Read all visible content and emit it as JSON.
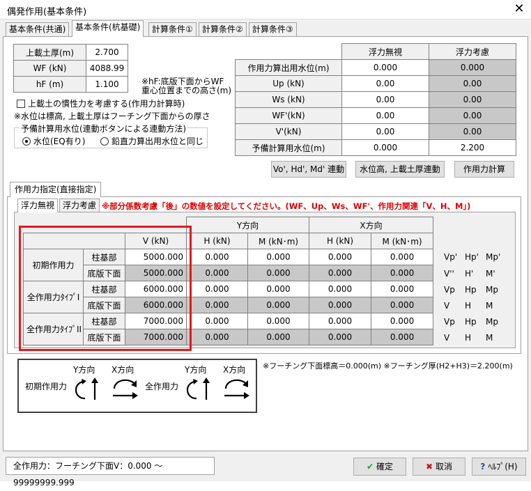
{
  "window": {
    "title": "偶発作用(基本条件)",
    "close": "✕"
  },
  "tabs": [
    "基本条件(共通)",
    "基本条件(杭基礎)",
    "計算条件①",
    "計算条件②",
    "計算条件③"
  ],
  "soil": {
    "rows": [
      {
        "label": "上載土厚(m)",
        "value": "2.700"
      },
      {
        "label": "WF (kN)",
        "value": "4088.99"
      },
      {
        "label": "hF (m)",
        "value": "1.100"
      }
    ],
    "hf_note_1": "※hF:底版下面からWF",
    "hf_note_2": "重心位置までの高さ(m)"
  },
  "inertia_checkbox": "上載土の慣性力を考慮する(作用力計算時)",
  "water_note": "※水位は標高, 上載土厚はフーチング下面からの厚さ",
  "reserve_group": {
    "title": "予備計算用水位(連動ボタンによる連動方法)",
    "option1": "水位(EQ有り)",
    "option2": "鉛直力算出用水位と同じ"
  },
  "buoyancy": {
    "headers": [
      "浮力無視",
      "浮力考慮"
    ],
    "rows": [
      {
        "label": "作用力算出用水位(m)",
        "a": "0.000",
        "b": "0.000"
      },
      {
        "label": "Up (kN)",
        "a": "0.00",
        "b": "0.00"
      },
      {
        "label": "Ws (kN)",
        "a": "0.00",
        "b": "0.00"
      },
      {
        "label": "WF'(kN)",
        "a": "0.00",
        "b": "0.00"
      },
      {
        "label": "V'(kN)",
        "a": "0.00",
        "b": "0.00"
      },
      {
        "label": "予備計算用水位(m)",
        "a": "0.000",
        "b": "2.200"
      }
    ]
  },
  "buttons": {
    "link_vhm": "Vo', Hd', Md' 連動",
    "link_water": "水位高, 上載土厚連動",
    "calc": "作用力計算"
  },
  "force_tab": "作用力指定(直接指定)",
  "sub_tabs": [
    "浮力無視",
    "浮力考慮"
  ],
  "red_note": "※部分係数考慮「後」の数値を設定してください。(WF、Up、Ws、WF'、作用力関連「V、H、M」)",
  "force_table": {
    "y_dir": "Y方向",
    "x_dir": "X方向",
    "col_v": "V (kN)",
    "col_h": "H (kN)",
    "col_m": "M (kN･m)",
    "groups": [
      {
        "name": "初期作用力",
        "rows": [
          {
            "part": "柱基部",
            "v": "5000.000",
            "yh": "0.000",
            "ym": "0.000",
            "xh": "0.000",
            "xm": "0.000",
            "syms": [
              "Vp'",
              "Hp'",
              "Mp'"
            ]
          },
          {
            "part": "底版下面",
            "v": "5000.000",
            "yh": "0.000",
            "ym": "0.000",
            "xh": "0.000",
            "xm": "0.000",
            "syms": [
              "V''",
              "H'",
              "M'"
            ]
          }
        ]
      },
      {
        "name": "全作用力ﾀｲﾌﾟI",
        "rows": [
          {
            "part": "柱基部",
            "v": "6000.000",
            "yh": "0.000",
            "ym": "0.000",
            "xh": "0.000",
            "xm": "0.000",
            "syms": [
              "Vp",
              "Hp",
              "Mp"
            ]
          },
          {
            "part": "底版下面",
            "v": "6000.000",
            "yh": "0.000",
            "ym": "0.000",
            "xh": "0.000",
            "xm": "0.000",
            "syms": [
              "V",
              "H",
              "M"
            ]
          }
        ]
      },
      {
        "name": "全作用力ﾀｲﾌﾟII",
        "rows": [
          {
            "part": "柱基部",
            "v": "7000.000",
            "yh": "0.000",
            "ym": "0.000",
            "xh": "0.000",
            "xm": "0.000",
            "syms": [
              "Vp",
              "Hp",
              "Mp"
            ]
          },
          {
            "part": "底版下面",
            "v": "7000.000",
            "yh": "0.000",
            "ym": "0.000",
            "xh": "0.000",
            "xm": "0.000",
            "syms": [
              "V",
              "H",
              "M"
            ]
          }
        ]
      }
    ]
  },
  "legend": {
    "initial": "初期作用力",
    "total": "全作用力",
    "y_dir": "Y方向",
    "x_dir": "X方向"
  },
  "footing_note": "※フーチング下面標高＝0.000(m)  ※フーチング厚(H2+H3)＝2.200(m)",
  "status": "全作用力：フーチング下面V：0.000 ～ 99999999.999",
  "footer": {
    "ok": "確定",
    "cancel": "取消",
    "help": "ﾍﾙﾌﾟ(H)"
  },
  "colors": {
    "highlight": "#e4181f",
    "red_note": "#e00000",
    "ok_check": "#1a9e1a",
    "cancel_x": "#cc1111"
  }
}
